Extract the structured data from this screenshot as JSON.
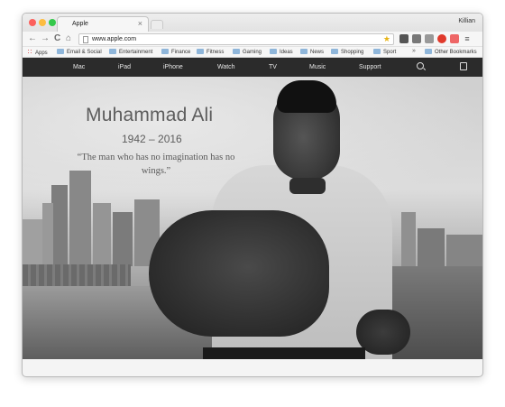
{
  "browser": {
    "tab_title": "Apple",
    "tab_close": "×",
    "profile_name": "Killian",
    "url": "www.apple.com",
    "nav": {
      "back": "←",
      "forward": "→",
      "reload": "C",
      "home": "⌂"
    },
    "bookmarks": [
      {
        "label": "Apps",
        "icon": "apps-grid-icon"
      },
      {
        "label": "Email & Social",
        "icon": "folder-icon"
      },
      {
        "label": "Entertainment",
        "icon": "folder-icon"
      },
      {
        "label": "Finance",
        "icon": "folder-icon"
      },
      {
        "label": "Fitness",
        "icon": "folder-icon"
      },
      {
        "label": "Gaming",
        "icon": "folder-icon"
      },
      {
        "label": "Ideas",
        "icon": "folder-icon"
      },
      {
        "label": "News",
        "icon": "folder-icon"
      },
      {
        "label": "Shopping",
        "icon": "folder-icon"
      },
      {
        "label": "Sport",
        "icon": "folder-icon"
      }
    ],
    "bookmarks_overflow": "»",
    "other_bookmarks": "Other Bookmarks",
    "menu": "≡"
  },
  "site_nav": {
    "logo": "",
    "items": [
      "Mac",
      "iPad",
      "iPhone",
      "Watch",
      "TV",
      "Music",
      "Support"
    ]
  },
  "hero": {
    "name": "Muhammad Ali",
    "years": "1942 – 2016",
    "quote": "“The man who has no imagination has no wings.”"
  },
  "colors": {
    "traffic_close": "#fc605c",
    "traffic_minimize": "#fdbc40",
    "traffic_zoom": "#34c84a",
    "site_nav_bg": "#2b2b2b",
    "hero_text": "#5d5d5d"
  }
}
